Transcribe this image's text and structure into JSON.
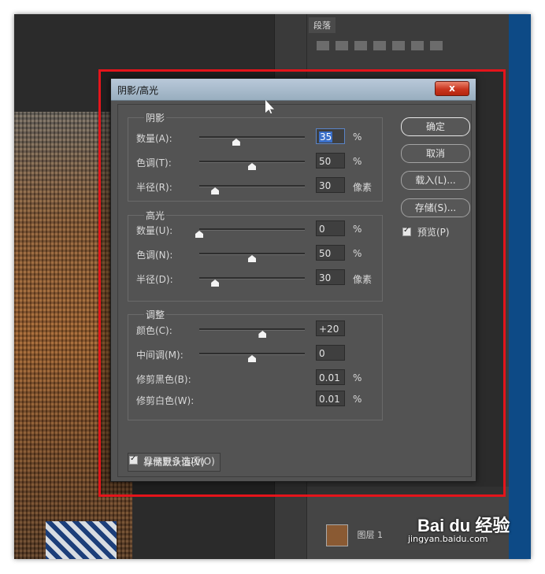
{
  "dialog": {
    "title": "阴影/高光",
    "close_label": "x",
    "sections": [
      {
        "title": "阴影",
        "rows": [
          {
            "label": "数量(A):",
            "value": "35",
            "unit": "%",
            "slider": 0.35,
            "focused": true
          },
          {
            "label": "色调(T):",
            "value": "50",
            "unit": "%",
            "slider": 0.5
          },
          {
            "label": "半径(R):",
            "value": "30",
            "unit": "像素",
            "slider": 0.15
          }
        ]
      },
      {
        "title": "高光",
        "rows": [
          {
            "label": "数量(U):",
            "value": "0",
            "unit": "%",
            "slider": 0.0
          },
          {
            "label": "色调(N):",
            "value": "50",
            "unit": "%",
            "slider": 0.5
          },
          {
            "label": "半径(D):",
            "value": "30",
            "unit": "像素",
            "slider": 0.15
          }
        ]
      },
      {
        "title": "调整",
        "rows": [
          {
            "label": "颜色(C):",
            "value": "+20",
            "unit": "",
            "slider": 0.6
          },
          {
            "label": "中间调(M):",
            "value": "0",
            "unit": "",
            "slider": 0.5
          },
          {
            "label": "修剪黑色(B):",
            "value": "0.01",
            "unit": "%"
          },
          {
            "label": "修剪白色(W):",
            "value": "0.01",
            "unit": "%"
          }
        ]
      }
    ],
    "buttons": {
      "ok": "确定",
      "cancel": "取消",
      "load": "载入(L)...",
      "save": "存储(S)..."
    },
    "preview_label": "预览(P)",
    "preview_checked": true,
    "save_defaults_label": "存储默认值(V)",
    "more_options_label": "显示更多选项(O)",
    "more_options_checked": true
  },
  "background": {
    "panel_tab": "段落",
    "layers": [
      {
        "name": "图层 1"
      }
    ]
  },
  "watermark": {
    "logo": "Bai du 经验",
    "url": "jingyan.baidu.com"
  },
  "colors": {
    "highlight_border": "#e4141b",
    "dialog_bg": "#535353",
    "titlebar": "#a6b8c8",
    "close_button": "#c9351f"
  }
}
